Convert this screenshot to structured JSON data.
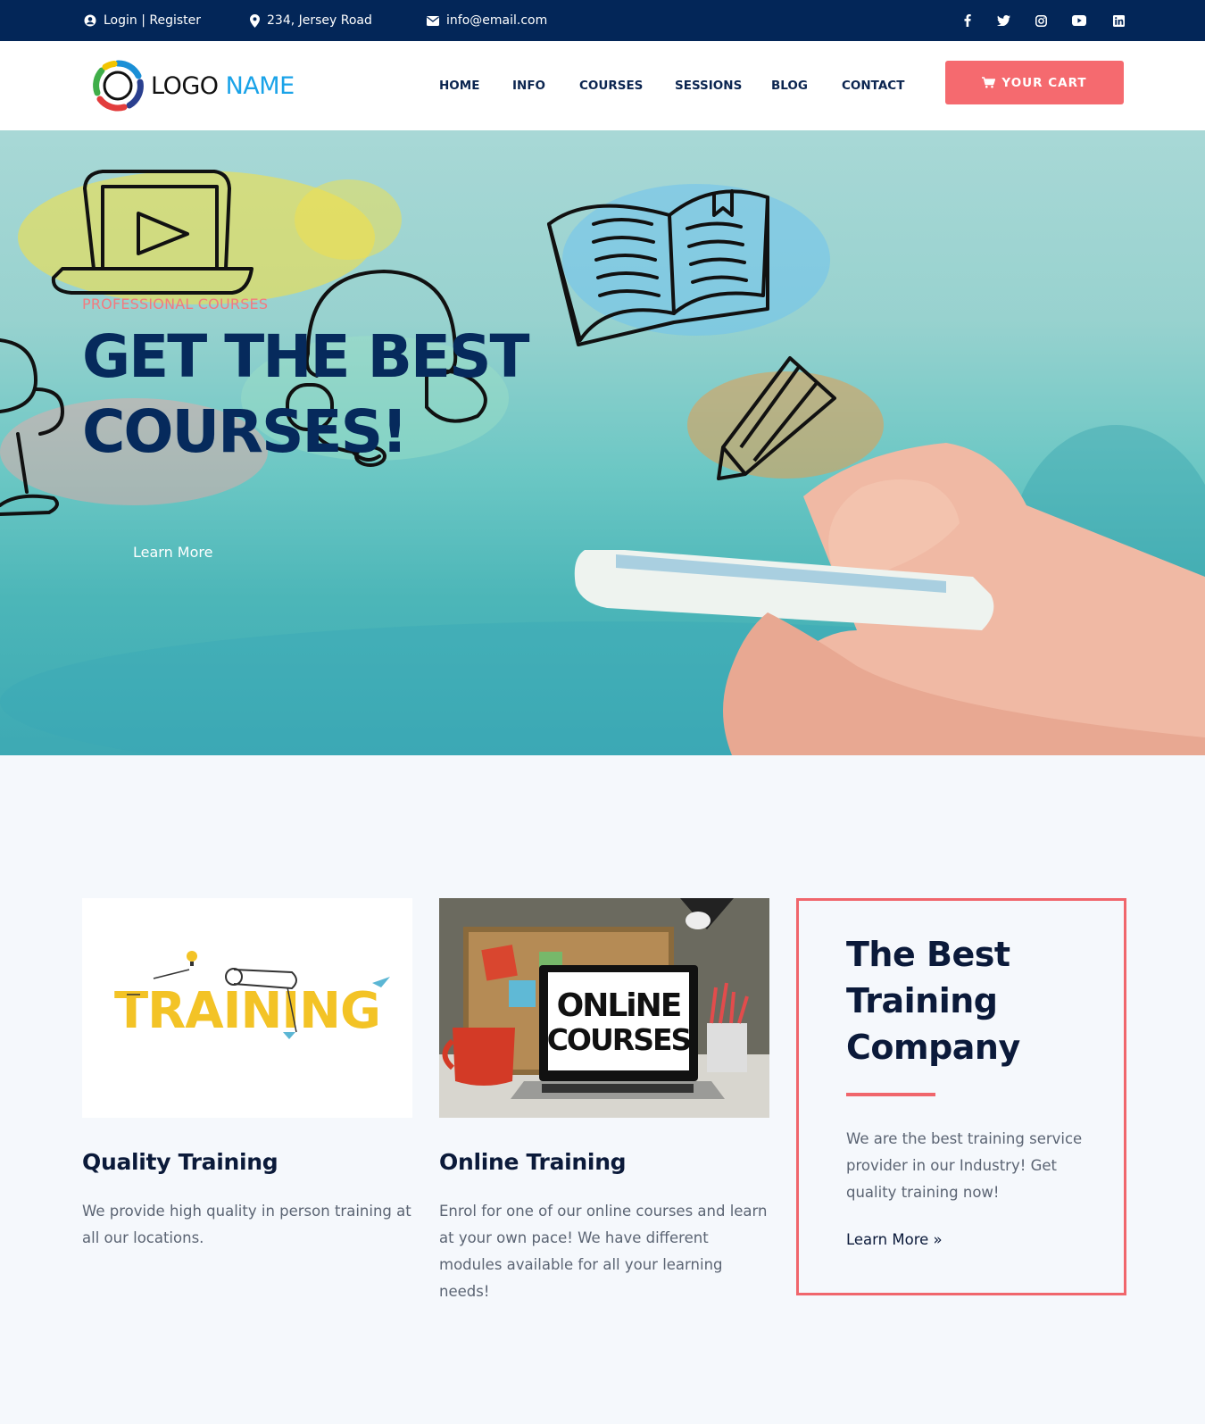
{
  "topbar": {
    "login_label": "Login | Register",
    "address": "234, Jersey Road",
    "email": "info@email.com",
    "social_icons": [
      "facebook-icon",
      "twitter-icon",
      "instagram-icon",
      "youtube-icon",
      "linkedin-icon"
    ]
  },
  "header": {
    "logo_word1": "LOGO",
    "logo_word2": "NAME",
    "nav": [
      "HOME",
      "INFO",
      "COURSES",
      "SESSIONS",
      "BLOG",
      "CONTACT"
    ],
    "cart_label": "YOUR CART"
  },
  "hero": {
    "eyebrow": "PROFESSIONAL COURSES",
    "title_line1": "GET THE BEST",
    "title_line2": "COURSES!",
    "cta": "Learn More"
  },
  "features": [
    {
      "image_text": "TRAINING",
      "title": "Quality Training",
      "text": "We provide high quality in person training at all our locations."
    },
    {
      "image_text_line1": "ONLiNE",
      "image_text_line2": "COURSES",
      "title": "Online Training",
      "text": "Enrol for one of our online courses and learn at your own pace! We have different modules available for all your learning needs!"
    }
  ],
  "promo": {
    "title": "The Best Training Company",
    "text": "We are the best training service provider in our Industry! Get quality training now!",
    "link": "Learn More »"
  },
  "colors": {
    "topbar_bg": "#032658",
    "accent": "#f56a6f",
    "navy": "#062a5c",
    "logo_blue": "#1aa3e8",
    "page_bg": "#f5f8fc"
  }
}
